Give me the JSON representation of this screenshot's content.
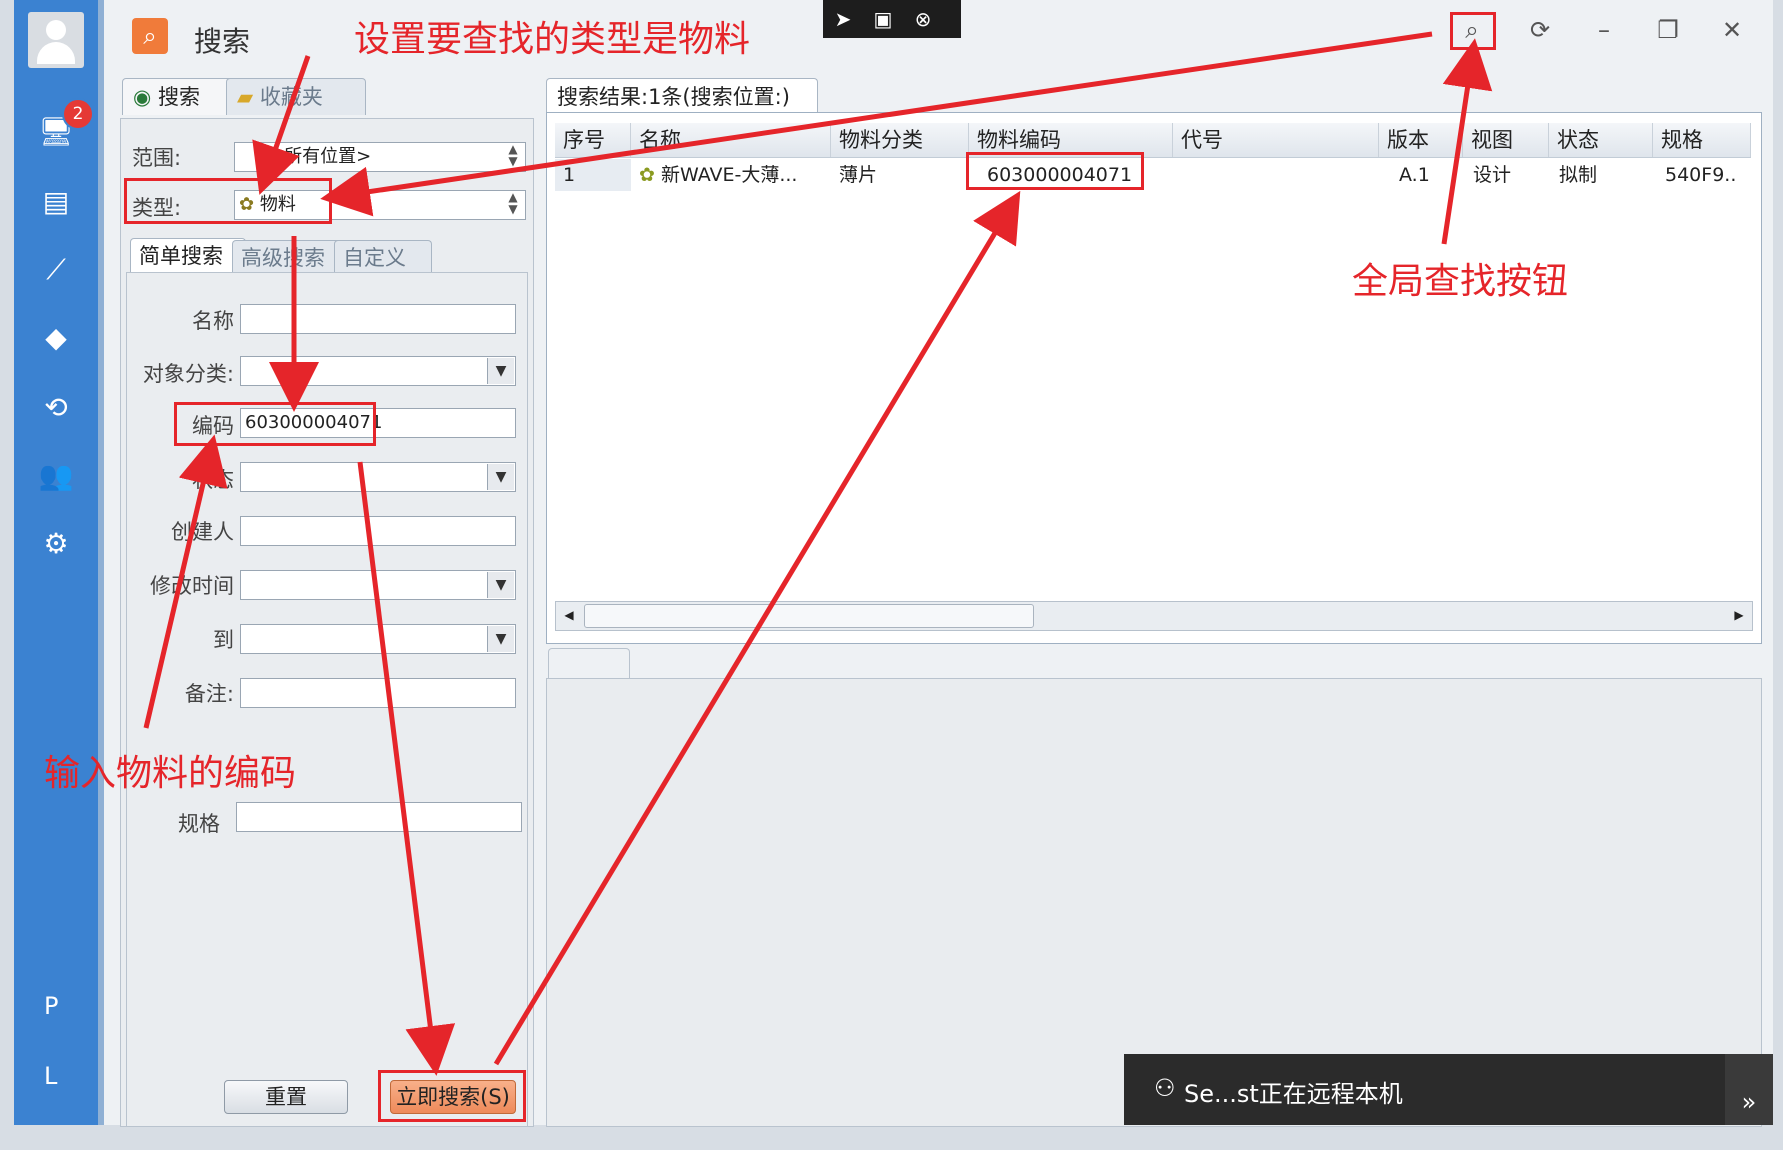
{
  "sidebar": {
    "badge_count": "2",
    "icons": [
      "monitor-icon",
      "document-list-icon",
      "chart-line-icon",
      "cube-icon",
      "sync-icon",
      "users-icon",
      "gear-icon"
    ],
    "letters": [
      "P",
      "L"
    ]
  },
  "window": {
    "title": "搜索"
  },
  "left_tabs": [
    {
      "label": "搜索"
    },
    {
      "label": "收藏夹"
    }
  ],
  "scope": {
    "label": "范围:",
    "value": "<所有位置>"
  },
  "type": {
    "label": "类型:",
    "value": "物料"
  },
  "subtabs": [
    {
      "label": "简单搜索"
    },
    {
      "label": "高级搜索"
    },
    {
      "label": "自定义"
    }
  ],
  "form": {
    "name_label": "名称",
    "category_label": "对象分类:",
    "code_label": "编码",
    "code_value": "603000004071",
    "status_label": "状态",
    "creator_label": "创建人",
    "modified_label": "修改时间",
    "to_label": "到",
    "remark_label": "备注:",
    "spec_label": "规格"
  },
  "buttons": {
    "reset": "重置",
    "search_now": "立即搜索(S)"
  },
  "results": {
    "tab_label": "搜索结果:1条(搜索位置:)",
    "columns": [
      "序号",
      "名称",
      "物料分类",
      "物料编码",
      "代号",
      "版本",
      "视图",
      "状态",
      "规格"
    ],
    "rows": [
      [
        "1",
        "新WAVE-大薄...",
        "薄片",
        "603000004071",
        "",
        "A.1",
        "设计",
        "拟制",
        "540F9.."
      ]
    ]
  },
  "annotations": {
    "type_note": "设置要查找的类型是物料",
    "global_note": "全局查找按钮",
    "code_note": "输入物料的编码"
  },
  "toast": {
    "text": "Se...st正在远程本机"
  },
  "colors": {
    "sidebar": "#3b82d1",
    "annotation": "#e5252a",
    "primary_button": "#ee8a5a"
  }
}
